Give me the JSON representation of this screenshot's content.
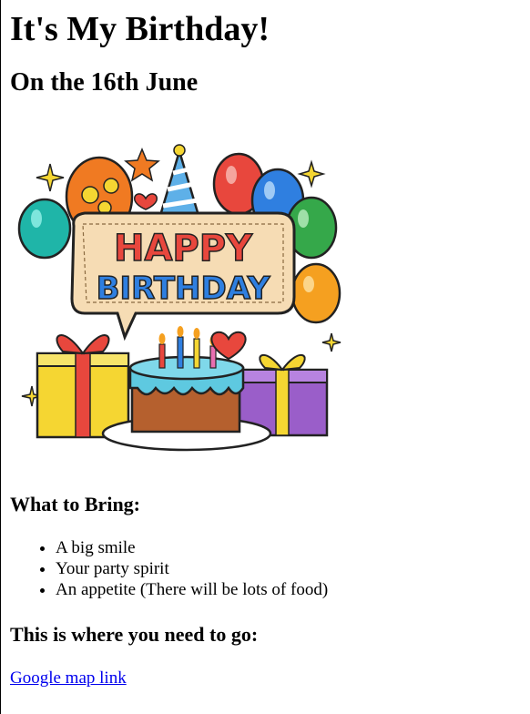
{
  "page": {
    "title": "It's My Birthday!",
    "date_heading": "On the 16th June"
  },
  "image": {
    "banner_line1": "HAPPY",
    "banner_line2": "BIRTHDAY",
    "colors": {
      "banner": "#f6dcb4",
      "cake_frosting": "#5ec9e0",
      "cake_base": "#b5602e",
      "balloon_orange": "#f07a22",
      "balloon_red": "#e8473d",
      "balloon_blue": "#2f7fe0",
      "balloon_green": "#35a84a",
      "balloon_teal": "#1fb5a8",
      "gift_yellow": "#f5d632",
      "gift_purple": "#9a5ec9"
    }
  },
  "bring": {
    "heading": "What to Bring:",
    "items": [
      "A big smile",
      "Your party spirit",
      "An appetite (There will be lots of food)"
    ]
  },
  "location": {
    "heading": "This is where you need to go:",
    "link_text": "Google map link"
  }
}
